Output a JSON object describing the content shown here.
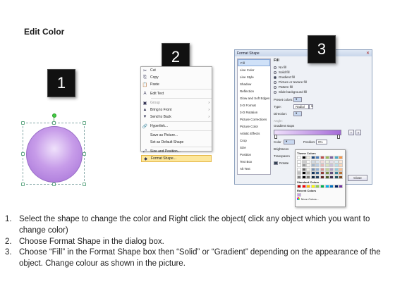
{
  "title": "Edit Color",
  "badges": [
    "1",
    "2",
    "3"
  ],
  "context_menu": [
    {
      "icon": "cut-icon",
      "glyph": "✂",
      "label": "Cut",
      "arrow": false
    },
    {
      "icon": "copy-icon",
      "glyph": "⎘",
      "label": "Copy",
      "arrow": false
    },
    {
      "icon": "paste-icon",
      "glyph": "📋",
      "label": "Paste",
      "arrow": false
    },
    {
      "icon": "edit-text-icon",
      "glyph": "A",
      "label": "Edit Text",
      "arrow": false
    },
    {
      "icon": "group-icon",
      "glyph": "▣",
      "label": "Group",
      "arrow": true,
      "disabled": true
    },
    {
      "icon": "bring-front-icon",
      "glyph": "▲",
      "label": "Bring to Front",
      "arrow": true
    },
    {
      "icon": "send-back-icon",
      "glyph": "▼",
      "label": "Send to Back",
      "arrow": true
    },
    {
      "icon": "hyperlink-icon",
      "glyph": "🔗",
      "label": "Hyperlink...",
      "arrow": false
    },
    {
      "icon": "save-picture-icon",
      "glyph": "",
      "label": "Save as Picture...",
      "arrow": false
    },
    {
      "icon": "default-shape-icon",
      "glyph": "",
      "label": "Set as Default Shape",
      "arrow": false
    },
    {
      "icon": "size-position-icon",
      "glyph": "⤢",
      "label": "Size and Position...",
      "arrow": false
    },
    {
      "icon": "format-shape-icon",
      "glyph": "◆",
      "label": "Format Shape...",
      "arrow": false,
      "highlight": true
    }
  ],
  "dialog": {
    "title": "Format Shape",
    "nav": [
      "Fill",
      "Line Color",
      "Line Style",
      "Shadow",
      "Reflection",
      "Glow and Soft Edges",
      "3-D Format",
      "3-D Rotation",
      "Picture Corrections",
      "Picture Color",
      "Artistic Effects",
      "Crop",
      "Size",
      "Position",
      "Text Box",
      "Alt Text"
    ],
    "section": "Fill",
    "options": [
      {
        "label": "No fill",
        "on": false
      },
      {
        "label": "Solid fill",
        "on": false
      },
      {
        "label": "Gradient fill",
        "on": true
      },
      {
        "label": "Picture or texture fill",
        "on": false
      },
      {
        "label": "Pattern fill",
        "on": false
      },
      {
        "label": "Slide background fill",
        "on": false
      }
    ],
    "preset_label": "Preset colors:",
    "type_label": "Type:",
    "type_value": "Radial",
    "direction_label": "Direction:",
    "angle_label": "Angle:",
    "gradient_stops_label": "Gradient stops",
    "color_label": "Color",
    "position_label": "Position:",
    "position_value": "0%",
    "brightness_label": "Brightness",
    "transparency_label": "Transparen",
    "rotate_label": "Rotate",
    "close_label": "Close"
  },
  "palette": {
    "theme_label": "Theme Colors",
    "standard_label": "Standard Colors",
    "recent_label": "Recent Colors",
    "more_label": "More Colors...",
    "theme_top": [
      "#ffffff",
      "#000000",
      "#eeece1",
      "#1f497d",
      "#4f81bd",
      "#c0504d",
      "#9bbb59",
      "#8064a2",
      "#4bacc6",
      "#f79646"
    ],
    "standard": [
      "#c00000",
      "#ff0000",
      "#ffc000",
      "#ffff00",
      "#92d050",
      "#00b050",
      "#00b0f0",
      "#0070c0",
      "#002060",
      "#7030a0"
    ],
    "recent": [
      "#c79ce9"
    ]
  },
  "steps": [
    {
      "n": "1.",
      "text": "Select the shape to change the color and Right click the object( click any object which you want to change color)"
    },
    {
      "n": "2.",
      "text": "Choose Format Shape in the dialog box."
    },
    {
      "n": "3.",
      "text": "Choose “Fill” in the Format Shape box then “Solid” or “Gradient” depending on the appearance of the object. Change colour as shown in the picture."
    }
  ]
}
